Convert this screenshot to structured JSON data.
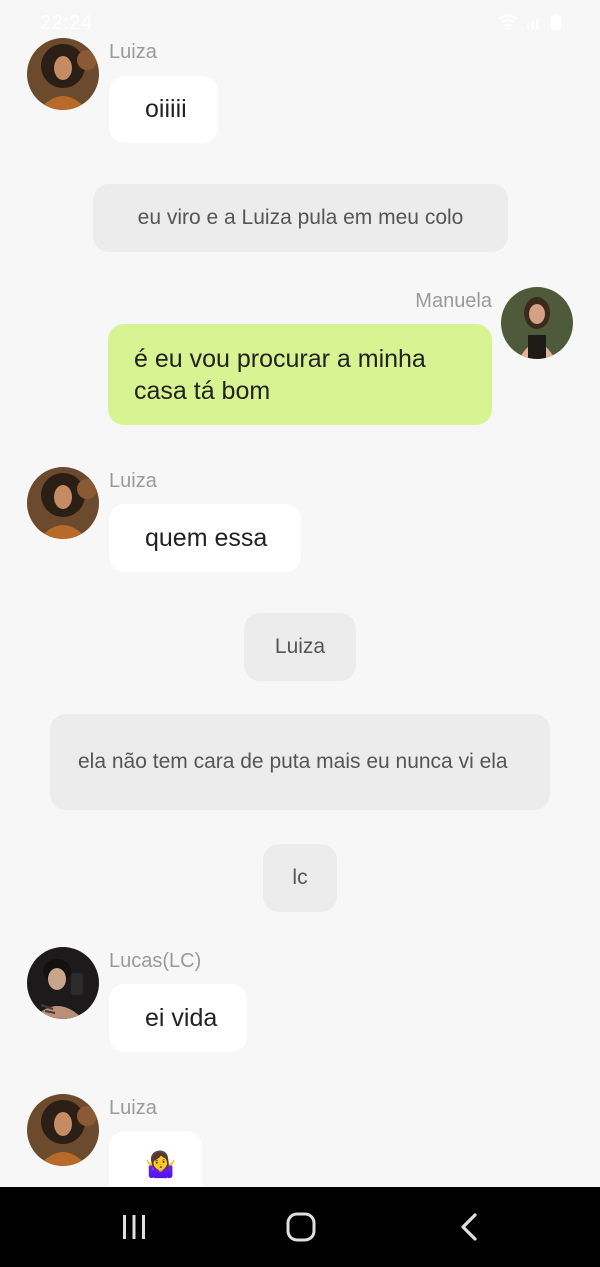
{
  "status_bar": {
    "time": "22:24",
    "icons": [
      "wifi-icon",
      "signal-icon",
      "battery-icon"
    ]
  },
  "chat": {
    "messages": [
      {
        "type": "received",
        "sender": "Luiza",
        "text": "oiiiii",
        "avatar": "luiza-avatar"
      },
      {
        "type": "narration",
        "text": "eu viro e a Luiza pula em meu colo"
      },
      {
        "type": "sent",
        "sender": "Manuela",
        "text": "é eu vou procurar a minha casa tá bom",
        "avatar": "manuela-avatar"
      },
      {
        "type": "received",
        "sender": "Luiza",
        "text": "quem essa",
        "avatar": "luiza-avatar"
      },
      {
        "type": "narration",
        "text": "Luiza"
      },
      {
        "type": "narration",
        "text": "ela não tem cara de puta mais eu nunca vi ela"
      },
      {
        "type": "narration",
        "text": "lc"
      },
      {
        "type": "received",
        "sender": "Lucas(LC)",
        "text": "ei vida",
        "avatar": "lucas-avatar"
      },
      {
        "type": "received",
        "sender": "Luiza",
        "text": "🤷‍♀️",
        "avatar": "luiza-avatar"
      }
    ]
  },
  "nav_bar": {
    "buttons": [
      "recent-apps-icon",
      "home-icon",
      "back-icon"
    ]
  },
  "colors": {
    "background": "#f7f7f7",
    "received_bubble": "#ffffff",
    "sent_bubble": "#d8f492",
    "narration_bubble": "#ececec",
    "sender_name": "#9a9a9a",
    "nav_bar": "#000000"
  }
}
